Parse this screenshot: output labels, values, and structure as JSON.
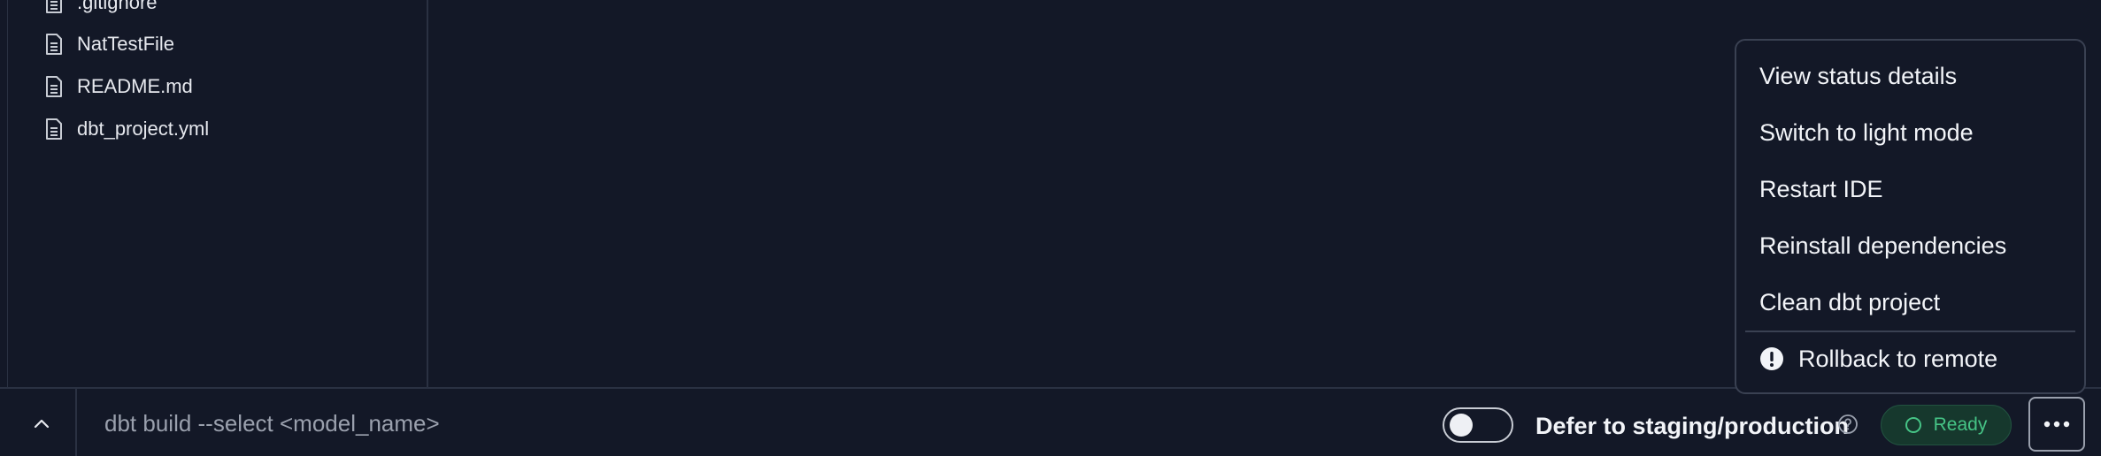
{
  "file_tree": {
    "items": [
      {
        "name": ".gitignore",
        "icon": "file-icon"
      },
      {
        "name": "NatTestFile",
        "icon": "file-icon"
      },
      {
        "name": "README.md",
        "icon": "file-icon"
      },
      {
        "name": "dbt_project.yml",
        "icon": "file-icon"
      }
    ]
  },
  "command_bar": {
    "collapse_icon": "chevron-up-icon",
    "command_placeholder": "dbt build --select <model_name>",
    "defer_toggle_on": false,
    "defer_label": "Defer to staging/production",
    "help_icon": "question-circle-icon",
    "status": "Ready",
    "status_color": "#46c486",
    "more_icon": "ellipsis-icon"
  },
  "menu": {
    "items": [
      {
        "label": "View status details"
      },
      {
        "label": "Switch to light mode"
      },
      {
        "label": "Restart IDE"
      },
      {
        "label": "Reinstall dependencies"
      },
      {
        "label": "Clean dbt project"
      }
    ],
    "danger_item": {
      "label": "Rollback to remote",
      "icon": "alert-circle-icon"
    }
  }
}
